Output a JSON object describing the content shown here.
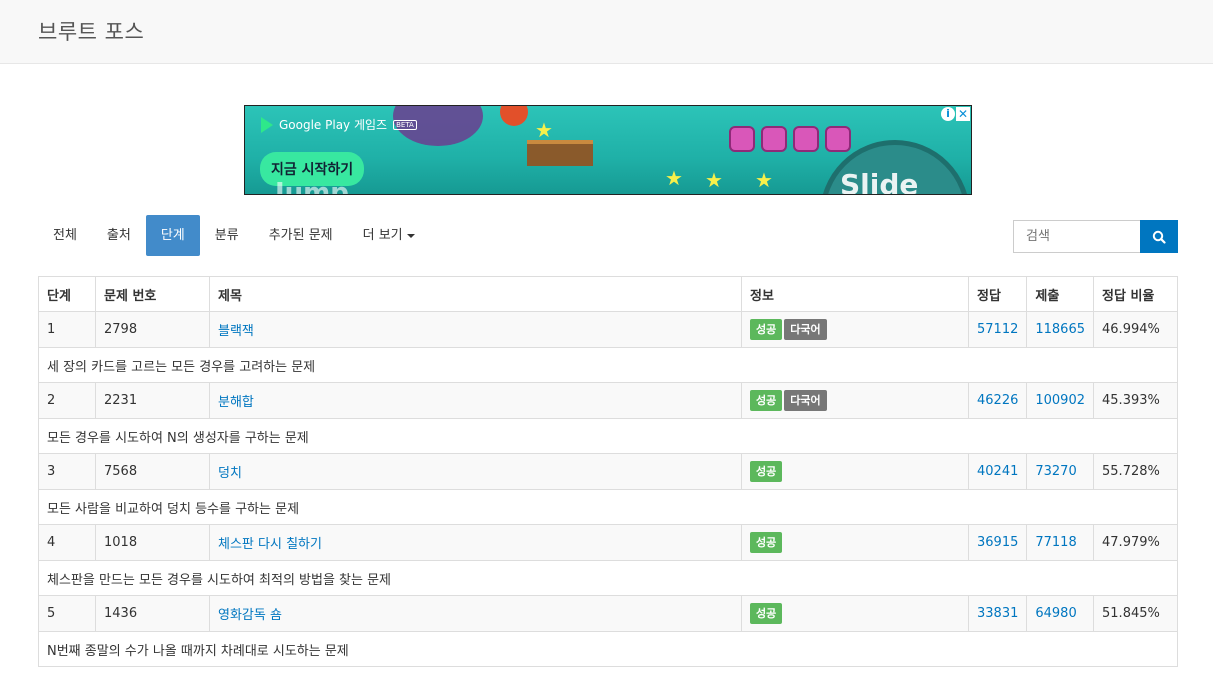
{
  "header": {
    "title": "브루트 포스"
  },
  "ad": {
    "brand": "Google Play 게임즈",
    "beta": "BETA",
    "cta": "지금 시작하기",
    "word_left": "Jump",
    "word_right": "Slide"
  },
  "nav": {
    "items": [
      {
        "label": "전체"
      },
      {
        "label": "출처"
      },
      {
        "label": "단계"
      },
      {
        "label": "분류"
      },
      {
        "label": "추가된 문제"
      },
      {
        "label": "더 보기"
      }
    ]
  },
  "search": {
    "placeholder": "검색"
  },
  "table": {
    "headers": [
      "단계",
      "문제 번호",
      "제목",
      "정보",
      "정답",
      "제출",
      "정답 비율"
    ],
    "success_label": "성공",
    "multi_label": "다국어",
    "rows": [
      {
        "level": "1",
        "id": "2798",
        "title": "블랙잭",
        "multi": true,
        "correct": "57112",
        "submit": "118665",
        "ratio": "46.994%",
        "desc": "세 장의 카드를 고르는 모든 경우를 고려하는 문제"
      },
      {
        "level": "2",
        "id": "2231",
        "title": "분해합",
        "multi": true,
        "correct": "46226",
        "submit": "100902",
        "ratio": "45.393%",
        "desc": "모든 경우를 시도하여 N의 생성자를 구하는 문제"
      },
      {
        "level": "3",
        "id": "7568",
        "title": "덩치",
        "multi": false,
        "correct": "40241",
        "submit": "73270",
        "ratio": "55.728%",
        "desc": "모든 사람을 비교하여 덩치 등수를 구하는 문제"
      },
      {
        "level": "4",
        "id": "1018",
        "title": "체스판 다시 칠하기",
        "multi": false,
        "correct": "36915",
        "submit": "77118",
        "ratio": "47.979%",
        "desc": "체스판을 만드는 모든 경우를 시도하여 최적의 방법을 찾는 문제"
      },
      {
        "level": "5",
        "id": "1436",
        "title": "영화감독 숌",
        "multi": false,
        "correct": "33831",
        "submit": "64980",
        "ratio": "51.845%",
        "desc": "N번째 종말의 수가 나올 때까지 차례대로 시도하는 문제"
      }
    ]
  },
  "colors": {
    "accent": "#428bca",
    "link": "#0076c0",
    "success": "#5cb85c",
    "multi": "#777777"
  }
}
